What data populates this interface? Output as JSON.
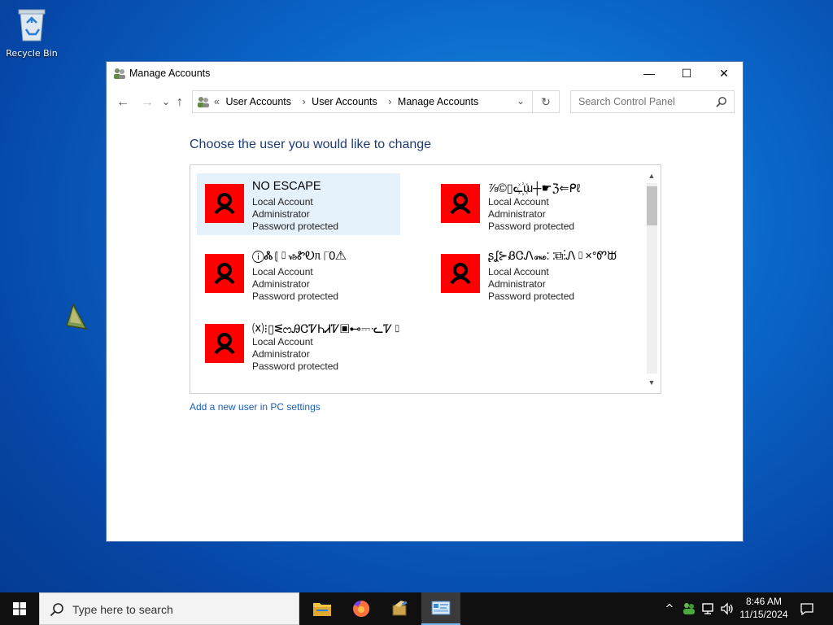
{
  "desktop": {
    "recycle_bin_label": "Recycle Bin"
  },
  "window": {
    "title": "Manage Accounts",
    "controls": {
      "minimize": "—",
      "maximize": "☐",
      "close": "✕"
    }
  },
  "nav": {
    "back": "←",
    "forward": "→",
    "recent": "⌄",
    "up": "↑",
    "address": {
      "overflow": "«",
      "crumbs": [
        "User Accounts",
        "User Accounts",
        "Manage Accounts"
      ],
      "separator": "›"
    },
    "search": {
      "placeholder": "Search Control Panel"
    }
  },
  "main": {
    "heading": "Choose the user you would like to change",
    "users": [
      {
        "name": "NO ESCAPE",
        "type": "Local Account",
        "role": "Administrator",
        "status": "Password protected",
        "selected": true
      },
      {
        "name": "⅞©▯ᓚ꙰ɯ┼☛ℨ⇐ᑭℓ",
        "type": "Local Account",
        "role": "Administrator",
        "status": "Password protected",
        "selected": false
      },
      {
        "name": "ⓘᏜ⦃▯ᏹᏑᎧᥰ⎾0⚠",
        "type": "Local Account",
        "role": "Administrator",
        "status": "Password protected",
        "selected": false
      },
      {
        "name": "ʂʆ⊱ᏰᏣᏁ꘏⸬⧉⁝Ꮑ▯×ᐤᏛᙔ",
        "type": "Local Account",
        "role": "Administrator",
        "status": "Password protected",
        "selected": false
      },
      {
        "name": "⒳⁝▯ᓬᦂᎯᏣᏤᏂᏗᏤ▣⊷⎓ᓦᏤ▯",
        "type": "Local Account",
        "role": "Administrator",
        "status": "Password protected",
        "selected": false
      }
    ],
    "add_user_link": "Add a new user in PC settings"
  },
  "taskbar": {
    "search_placeholder": "Type here to search",
    "tray": {
      "chevron": "^"
    },
    "clock": {
      "time": "8:46 AM",
      "date": "11/15/2024"
    }
  },
  "colors": {
    "accent": "#1f3b73",
    "link": "#1a5fb4",
    "avatar_bg": "#ff0000",
    "selected_bg": "#e5f1fb"
  }
}
